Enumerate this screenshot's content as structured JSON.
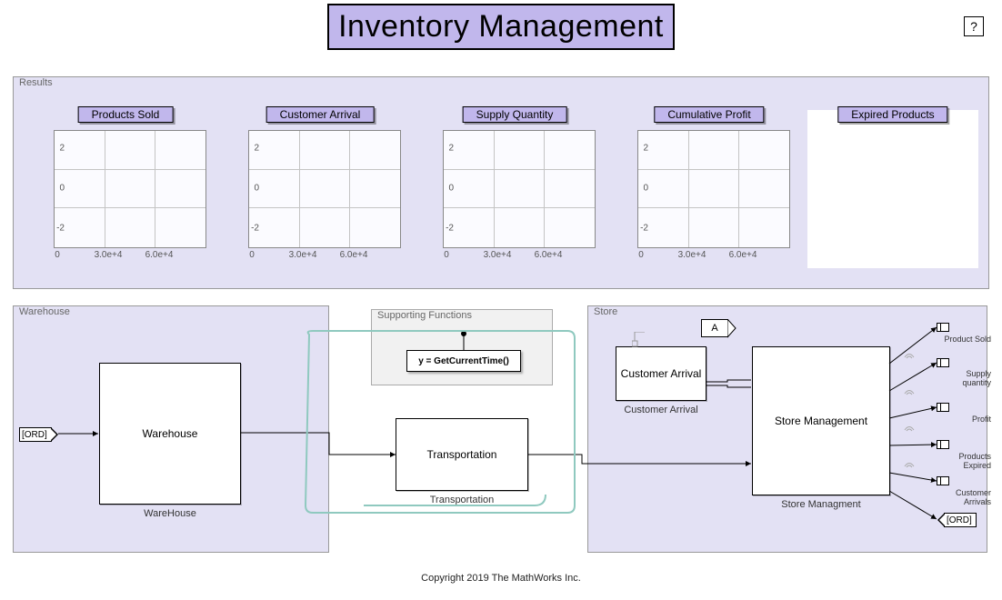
{
  "title": "Inventory Management",
  "help": "?",
  "copyright": "Copyright 2019 The MathWorks Inc.",
  "panels": {
    "results_title": "Results",
    "warehouse_title": "Warehouse",
    "supfn_title": "Supporting Functions",
    "store_title": "Store"
  },
  "results": {
    "charts": [
      {
        "label": "Products Sold"
      },
      {
        "label": "Customer Arrival"
      },
      {
        "label": "Supply Quantity"
      },
      {
        "label": "Cumulative Profit"
      },
      {
        "label": "Expired Products"
      }
    ],
    "y_ticks": [
      "2",
      "0",
      "-2"
    ],
    "x_ticks": [
      "0",
      "3.0e+4",
      "6.0e+4"
    ]
  },
  "warehouse": {
    "ord_tag": "[ORD]",
    "block": "Warehouse",
    "block_caption": "WareHouse"
  },
  "supfn": {
    "formula": "y = GetCurrentTime()"
  },
  "transportation": {
    "block": "Transportation",
    "caption": "Transportation"
  },
  "store": {
    "a_tag": "A",
    "cust_block": "Customer Arrival",
    "cust_caption": "Customer Arrival",
    "mgmt_block": "Store Management",
    "mgmt_caption": "Store Managment"
  },
  "outputs": [
    "Product Sold",
    "Supply quantity",
    "Profit",
    "Products Expired",
    "Customer Arrivals"
  ],
  "ord_out": "[ORD]",
  "chart_data": {
    "type": "line",
    "series": [
      {
        "name": "Products Sold",
        "x": [],
        "y": []
      },
      {
        "name": "Customer Arrival",
        "x": [],
        "y": []
      },
      {
        "name": "Supply Quantity",
        "x": [],
        "y": []
      },
      {
        "name": "Cumulative Profit",
        "x": [],
        "y": []
      },
      {
        "name": "Expired Products",
        "x": [],
        "y": []
      }
    ],
    "xlim": [
      0,
      60000
    ],
    "ylim": [
      -3,
      3
    ],
    "x_ticks": [
      0,
      30000,
      60000
    ],
    "y_ticks": [
      -2,
      0,
      2
    ],
    "xlabel": "",
    "ylabel": ""
  }
}
